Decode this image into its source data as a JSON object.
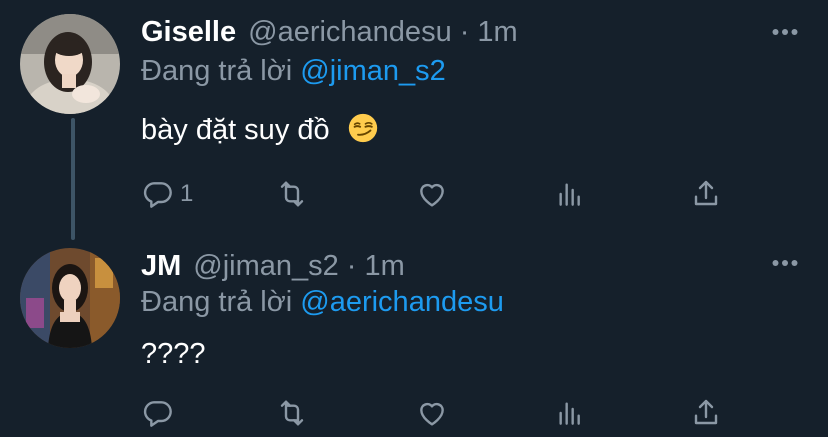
{
  "colors": {
    "background": "#15202b",
    "text_primary": "#ffffff",
    "text_secondary": "#8b98a5",
    "accent": "#1d9bf0",
    "thread_line": "#3d5466"
  },
  "tweets": [
    {
      "display_name": "Giselle",
      "handle": "@aerichandesu",
      "separator": "·",
      "time": "1m",
      "reply_prefix": "Đang trả lời",
      "reply_to": "@jiman_s2",
      "text": "bày đặt suy đồ",
      "emoji": "smirking-face-emoji",
      "reply_count": "1",
      "icons": [
        "reply-icon",
        "retweet-icon",
        "like-icon",
        "stats-icon",
        "share-icon",
        "more-icon"
      ]
    },
    {
      "display_name": "JM",
      "handle": "@jiman_s2",
      "separator": "·",
      "time": "1m",
      "reply_prefix": "Đang trả lời",
      "reply_to": "@aerichandesu",
      "text": "????",
      "reply_count": "",
      "icons": [
        "reply-icon",
        "retweet-icon",
        "like-icon",
        "stats-icon",
        "share-icon",
        "more-icon"
      ]
    }
  ]
}
